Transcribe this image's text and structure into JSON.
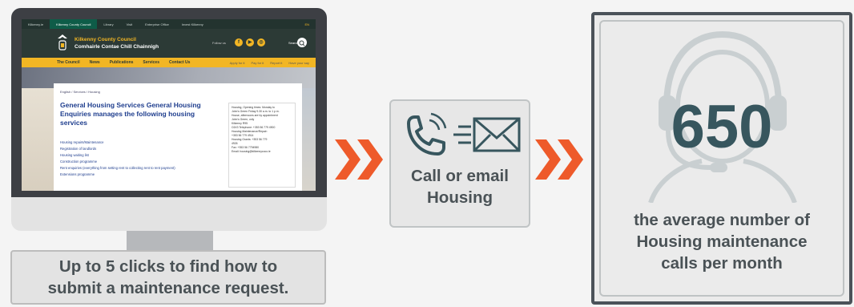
{
  "monitor": {
    "topbar": [
      "Kilkenny.ie",
      "Kilkenny County Council",
      "Library",
      "Visit",
      "Enterprise Office",
      "Invest Kilkenny"
    ],
    "topbar_lang": "EN",
    "council_en": "Kilkenny County Council",
    "council_ga": "Comhairle Contae Chill Chainnigh",
    "follow_label": "Follow us",
    "search_label": "Search",
    "nav": [
      "The Council",
      "News",
      "Publications",
      "Services",
      "Contact Us"
    ],
    "nav_right": [
      "Apply for it",
      "Pay for it",
      "Report it",
      "Have your say"
    ],
    "breadcrumb": "English / Services / Housing",
    "heading": "General Housing Services General Housing Enquiries manages the following housing services",
    "links": [
      "Housing repairs/Maintenance",
      "Registration of landlords",
      "Housing waiting list",
      "Construction programme",
      "Rent enquiries (everything from setting rent to collecting rent to rent payment)",
      "Extensions programme"
    ],
    "infobox": [
      "Housing,    Opening times: Monday to",
      "John's Green  Friday 9.30 a.m. to 1 p.m.",
      "House,       afternoons are by appointment",
      "John's Green, only",
      "Kilkenny R95",
      "C6X3        Telephone: +353 56 779 4900",
      "             Housing Maintenance/Repair:",
      "             +353 56 779 4914",
      "             Housing Grants: +353 56 779",
      "             4926",
      "             Fax: +353 56 7794980",
      "             Email: housing@kilkennycoco.ie"
    ]
  },
  "left_caption": [
    "Up to 5 clicks to find how to",
    "submit a maintenance request."
  ],
  "middle": {
    "line1": "Call or email",
    "line2": "Housing"
  },
  "right": {
    "number": "650",
    "caption": [
      "the average number of",
      "Housing maintenance",
      "calls per month"
    ]
  },
  "colors": {
    "chevron": "#ee5a2a",
    "accent_yellow": "#f2b624",
    "teal": "#37565e"
  }
}
